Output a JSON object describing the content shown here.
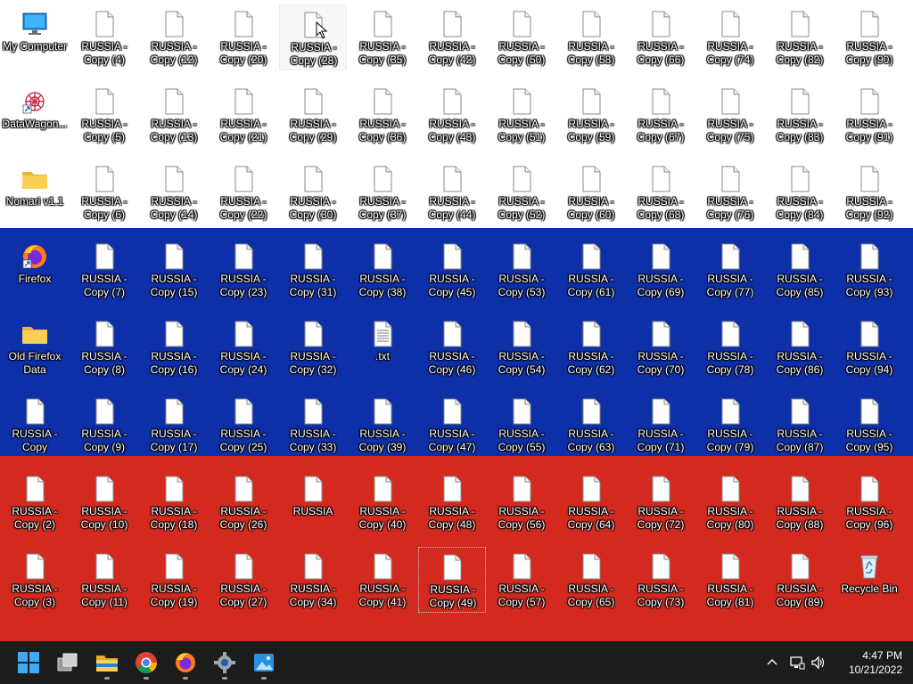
{
  "desktop": {
    "flag_colors": [
      "#ffffff",
      "#0d2fa8",
      "#d3291f"
    ],
    "columns": [
      [
        {
          "label": "My Computer",
          "icon": "computer-icon"
        },
        {
          "label": "DataWagon...",
          "icon": "shortcut-app-icon"
        },
        {
          "label": "Nomari v1.1",
          "icon": "folder-icon"
        },
        {
          "label": "Firefox",
          "icon": "firefox-icon"
        },
        {
          "label": "Old Firefox Data",
          "icon": "folder-icon"
        },
        {
          "label": "RUSSIA - Copy",
          "icon": "file-icon"
        },
        {
          "label": "RUSSIA - Copy (2)",
          "icon": "file-icon"
        },
        {
          "label": "RUSSIA - Copy (3)",
          "icon": "file-icon"
        }
      ],
      [
        {
          "label": "RUSSIA - Copy (4)",
          "icon": "file-icon"
        },
        {
          "label": "RUSSIA - Copy (5)",
          "icon": "file-icon"
        },
        {
          "label": "RUSSIA - Copy (6)",
          "icon": "file-icon"
        },
        {
          "label": "RUSSIA - Copy (7)",
          "icon": "file-icon"
        },
        {
          "label": "RUSSIA - Copy (8)",
          "icon": "file-icon"
        },
        {
          "label": "RUSSIA - Copy (9)",
          "icon": "file-icon"
        },
        {
          "label": "RUSSIA - Copy (10)",
          "icon": "file-icon"
        },
        {
          "label": "RUSSIA - Copy (11)",
          "icon": "file-icon"
        }
      ],
      [
        {
          "label": "RUSSIA - Copy (12)",
          "icon": "file-icon"
        },
        {
          "label": "RUSSIA - Copy (13)",
          "icon": "file-icon"
        },
        {
          "label": "RUSSIA - Copy (14)",
          "icon": "file-icon"
        },
        {
          "label": "RUSSIA - Copy (15)",
          "icon": "file-icon"
        },
        {
          "label": "RUSSIA - Copy (16)",
          "icon": "file-icon"
        },
        {
          "label": "RUSSIA - Copy (17)",
          "icon": "file-icon"
        },
        {
          "label": "RUSSIA - Copy (18)",
          "icon": "file-icon"
        },
        {
          "label": "RUSSIA - Copy (19)",
          "icon": "file-icon"
        }
      ],
      [
        {
          "label": "RUSSIA - Copy (20)",
          "icon": "file-icon"
        },
        {
          "label": "RUSSIA - Copy (21)",
          "icon": "file-icon"
        },
        {
          "label": "RUSSIA - Copy (22)",
          "icon": "file-icon"
        },
        {
          "label": "RUSSIA - Copy (23)",
          "icon": "file-icon"
        },
        {
          "label": "RUSSIA - Copy (24)",
          "icon": "file-icon"
        },
        {
          "label": "RUSSIA - Copy (25)",
          "icon": "file-icon"
        },
        {
          "label": "RUSSIA - Copy (26)",
          "icon": "file-icon"
        },
        {
          "label": "RUSSIA - Copy (27)",
          "icon": "file-icon"
        }
      ],
      [
        {
          "label": "RUSSIA - Copy (28)",
          "icon": "file-icon",
          "hover": true
        },
        {
          "label": "RUSSIA - Copy (29)",
          "icon": "file-icon"
        },
        {
          "label": "RUSSIA - Copy (30)",
          "icon": "file-icon"
        },
        {
          "label": "RUSSIA - Copy (31)",
          "icon": "file-icon"
        },
        {
          "label": "RUSSIA - Copy (32)",
          "icon": "file-icon"
        },
        {
          "label": "RUSSIA - Copy (33)",
          "icon": "file-icon"
        },
        {
          "label": "RUSSIA",
          "icon": "file-icon"
        },
        {
          "label": "RUSSIA - Copy (34)",
          "icon": "file-icon"
        }
      ],
      [
        {
          "label": "RUSSIA - Copy (35)",
          "icon": "file-icon"
        },
        {
          "label": "RUSSIA - Copy (36)",
          "icon": "file-icon"
        },
        {
          "label": "RUSSIA - Copy (37)",
          "icon": "file-icon"
        },
        {
          "label": "RUSSIA - Copy (38)",
          "icon": "file-icon"
        },
        {
          "label": ".txt",
          "icon": "text-file-icon"
        },
        {
          "label": "RUSSIA - Copy (39)",
          "icon": "file-icon"
        },
        {
          "label": "RUSSIA - Copy (40)",
          "icon": "file-icon"
        },
        {
          "label": "RUSSIA - Copy (41)",
          "icon": "file-icon"
        }
      ],
      [
        {
          "label": "RUSSIA - Copy (42)",
          "icon": "file-icon"
        },
        {
          "label": "RUSSIA - Copy (43)",
          "icon": "file-icon"
        },
        {
          "label": "RUSSIA - Copy (44)",
          "icon": "file-icon"
        },
        {
          "label": "RUSSIA - Copy (45)",
          "icon": "file-icon"
        },
        {
          "label": "RUSSIA - Copy (46)",
          "icon": "file-icon"
        },
        {
          "label": "RUSSIA - Copy (47)",
          "icon": "file-icon"
        },
        {
          "label": "RUSSIA - Copy (48)",
          "icon": "file-icon"
        },
        {
          "label": "RUSSIA - Copy (49)",
          "icon": "file-icon",
          "selected": true
        }
      ],
      [
        {
          "label": "RUSSIA - Copy (50)",
          "icon": "file-icon"
        },
        {
          "label": "RUSSIA - Copy (51)",
          "icon": "file-icon"
        },
        {
          "label": "RUSSIA - Copy (52)",
          "icon": "file-icon"
        },
        {
          "label": "RUSSIA - Copy (53)",
          "icon": "file-icon"
        },
        {
          "label": "RUSSIA - Copy (54)",
          "icon": "file-icon"
        },
        {
          "label": "RUSSIA - Copy (55)",
          "icon": "file-icon"
        },
        {
          "label": "RUSSIA - Copy (56)",
          "icon": "file-icon"
        },
        {
          "label": "RUSSIA - Copy (57)",
          "icon": "file-icon"
        }
      ],
      [
        {
          "label": "RUSSIA - Copy (58)",
          "icon": "file-icon"
        },
        {
          "label": "RUSSIA - Copy (59)",
          "icon": "file-icon"
        },
        {
          "label": "RUSSIA - Copy (60)",
          "icon": "file-icon"
        },
        {
          "label": "RUSSIA - Copy (61)",
          "icon": "file-icon"
        },
        {
          "label": "RUSSIA - Copy (62)",
          "icon": "file-icon"
        },
        {
          "label": "RUSSIA - Copy (63)",
          "icon": "file-icon"
        },
        {
          "label": "RUSSIA - Copy (64)",
          "icon": "file-icon"
        },
        {
          "label": "RUSSIA - Copy (65)",
          "icon": "file-icon"
        }
      ],
      [
        {
          "label": "RUSSIA - Copy (66)",
          "icon": "file-icon"
        },
        {
          "label": "RUSSIA - Copy (67)",
          "icon": "file-icon"
        },
        {
          "label": "RUSSIA - Copy (68)",
          "icon": "file-icon"
        },
        {
          "label": "RUSSIA - Copy (69)",
          "icon": "file-icon"
        },
        {
          "label": "RUSSIA - Copy (70)",
          "icon": "file-icon"
        },
        {
          "label": "RUSSIA - Copy (71)",
          "icon": "file-icon"
        },
        {
          "label": "RUSSIA - Copy (72)",
          "icon": "file-icon"
        },
        {
          "label": "RUSSIA - Copy (73)",
          "icon": "file-icon"
        }
      ],
      [
        {
          "label": "RUSSIA - Copy (74)",
          "icon": "file-icon"
        },
        {
          "label": "RUSSIA - Copy (75)",
          "icon": "file-icon"
        },
        {
          "label": "RUSSIA - Copy (76)",
          "icon": "file-icon"
        },
        {
          "label": "RUSSIA - Copy (77)",
          "icon": "file-icon"
        },
        {
          "label": "RUSSIA - Copy (78)",
          "icon": "file-icon"
        },
        {
          "label": "RUSSIA - Copy (79)",
          "icon": "file-icon"
        },
        {
          "label": "RUSSIA - Copy (80)",
          "icon": "file-icon"
        },
        {
          "label": "RUSSIA - Copy (81)",
          "icon": "file-icon"
        }
      ],
      [
        {
          "label": "RUSSIA - Copy (82)",
          "icon": "file-icon"
        },
        {
          "label": "RUSSIA - Copy (83)",
          "icon": "file-icon"
        },
        {
          "label": "RUSSIA - Copy (84)",
          "icon": "file-icon"
        },
        {
          "label": "RUSSIA - Copy (85)",
          "icon": "file-icon"
        },
        {
          "label": "RUSSIA - Copy (86)",
          "icon": "file-icon"
        },
        {
          "label": "RUSSIA - Copy (87)",
          "icon": "file-icon"
        },
        {
          "label": "RUSSIA - Copy (88)",
          "icon": "file-icon"
        },
        {
          "label": "RUSSIA - Copy (89)",
          "icon": "file-icon"
        }
      ],
      [
        {
          "label": "RUSSIA - Copy (90)",
          "icon": "file-icon"
        },
        {
          "label": "RUSSIA - Copy (91)",
          "icon": "file-icon"
        },
        {
          "label": "RUSSIA - Copy (92)",
          "icon": "file-icon"
        },
        {
          "label": "RUSSIA - Copy (93)",
          "icon": "file-icon"
        },
        {
          "label": "RUSSIA - Copy (94)",
          "icon": "file-icon"
        },
        {
          "label": "RUSSIA - Copy (95)",
          "icon": "file-icon"
        },
        {
          "label": "RUSSIA - Copy (96)",
          "icon": "file-icon"
        },
        {
          "label": "Recycle Bin",
          "icon": "recycle-bin-icon"
        }
      ]
    ]
  },
  "taskbar": {
    "background": "#1c1c1c",
    "apps": [
      {
        "name": "start-button",
        "icon": "windows-logo-icon",
        "running": false
      },
      {
        "name": "task-view-button",
        "icon": "task-view-icon",
        "running": false
      },
      {
        "name": "file-explorer-button",
        "icon": "folder-icon",
        "running": true
      },
      {
        "name": "chrome-button",
        "icon": "chrome-icon",
        "running": true
      },
      {
        "name": "firefox-button",
        "icon": "firefox-icon",
        "running": true
      },
      {
        "name": "settings-button",
        "icon": "gear-icon",
        "running": true
      },
      {
        "name": "photos-button",
        "icon": "photos-icon",
        "running": true
      }
    ],
    "tray": {
      "icons": [
        "chevron-up-icon",
        "network-icon",
        "volume-icon"
      ],
      "time": "4:47 PM",
      "date": "10/21/2022"
    }
  }
}
